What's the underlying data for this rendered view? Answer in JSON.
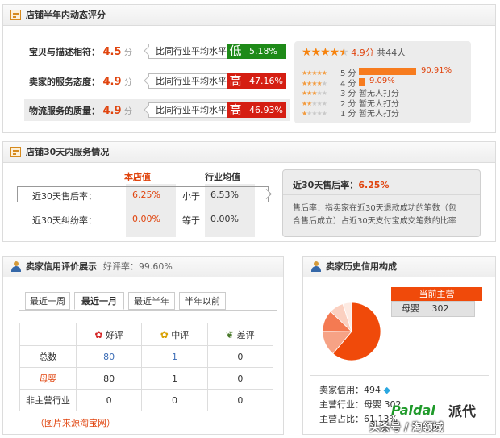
{
  "dsr": {
    "title": "店铺半年内动态评分",
    "rows": [
      {
        "label": "宝贝与描述相符：",
        "score": "4.5",
        "unit": "分",
        "compare": "比同行业平均水平",
        "level": "低",
        "pct": "5.18%",
        "color": "#1e8a18"
      },
      {
        "label": "卖家的服务态度：",
        "score": "4.9",
        "unit": "分",
        "compare": "比同行业平均水平",
        "level": "高",
        "pct": "47.16%",
        "color": "#d51e12"
      },
      {
        "label": "物流服务的质量：",
        "score": "4.9",
        "unit": "分",
        "compare": "比同行业平均水平",
        "level": "高",
        "pct": "46.93%",
        "color": "#d51e12"
      }
    ],
    "summary": {
      "score": "4.9",
      "unit": "分",
      "count_label": "共44人",
      "stars_filled": 4.5
    },
    "distribution": [
      {
        "stars": 5,
        "label": "5 分",
        "pct_text": "90.91%",
        "pct": 90.91
      },
      {
        "stars": 4,
        "label": "4 分",
        "pct_text": "9.09%",
        "pct": 9.09
      },
      {
        "stars": 3,
        "label": "3 分",
        "pct_text": "暂无人打分",
        "pct": 0
      },
      {
        "stars": 2,
        "label": "2 分",
        "pct_text": "暂无人打分",
        "pct": 0
      },
      {
        "stars": 1,
        "label": "1 分",
        "pct_text": "暂无人打分",
        "pct": 0
      }
    ]
  },
  "service": {
    "title": "店铺30天内服务情况",
    "col_store": "本店值",
    "col_industry": "行业均值",
    "rows": [
      {
        "label": "近30天售后率：",
        "store": "6.25%",
        "relation": "小于",
        "industry": "6.53%"
      },
      {
        "label": "近30天纠纷率：",
        "store": "0.00%",
        "relation": "等于",
        "industry": "0.00%"
      }
    ],
    "detail_title": "近30天售后率：",
    "detail_value": "6.25%",
    "detail_text_1": "售后率：指卖家在近30天退款成功的笔数（包",
    "detail_text_2": "含售后成立）占近30天支付宝成交笔数的比率"
  },
  "credit": {
    "title": "卖家信用评价展示",
    "rate_label": "好评率：99.60%",
    "tabs": [
      "最近一周",
      "最近一月",
      "最近半年",
      "半年以前"
    ],
    "active_tab": 1,
    "headers": [
      "好评",
      "中评",
      "差评"
    ],
    "rows": [
      {
        "label": "总数",
        "values": [
          "80",
          "1",
          "0"
        ]
      },
      {
        "label": "母婴",
        "values": [
          "80",
          "1",
          "0"
        ]
      },
      {
        "label": "非主营行业",
        "values": [
          "0",
          "0",
          "0"
        ]
      }
    ],
    "source_note": "（图片来源淘宝网）"
  },
  "history": {
    "title": "卖家历史信用构成",
    "current_label": "当前主营",
    "category": "母婴",
    "category_value": "302",
    "line1": "卖家信用：494",
    "line2": "主营行业：母婴  302",
    "line3": "主营占比：61.13%",
    "pie": [
      61.13,
      14,
      12,
      8,
      4.87
    ],
    "pie_colors": [
      "#f04a0a",
      "#f6a285",
      "#f47a52",
      "#fbd0c0",
      "#fdeae2"
    ]
  },
  "watermark": {
    "brand_a": "Paidai",
    "brand_b": "派代",
    "caption": "头条号 / 淘领域"
  }
}
